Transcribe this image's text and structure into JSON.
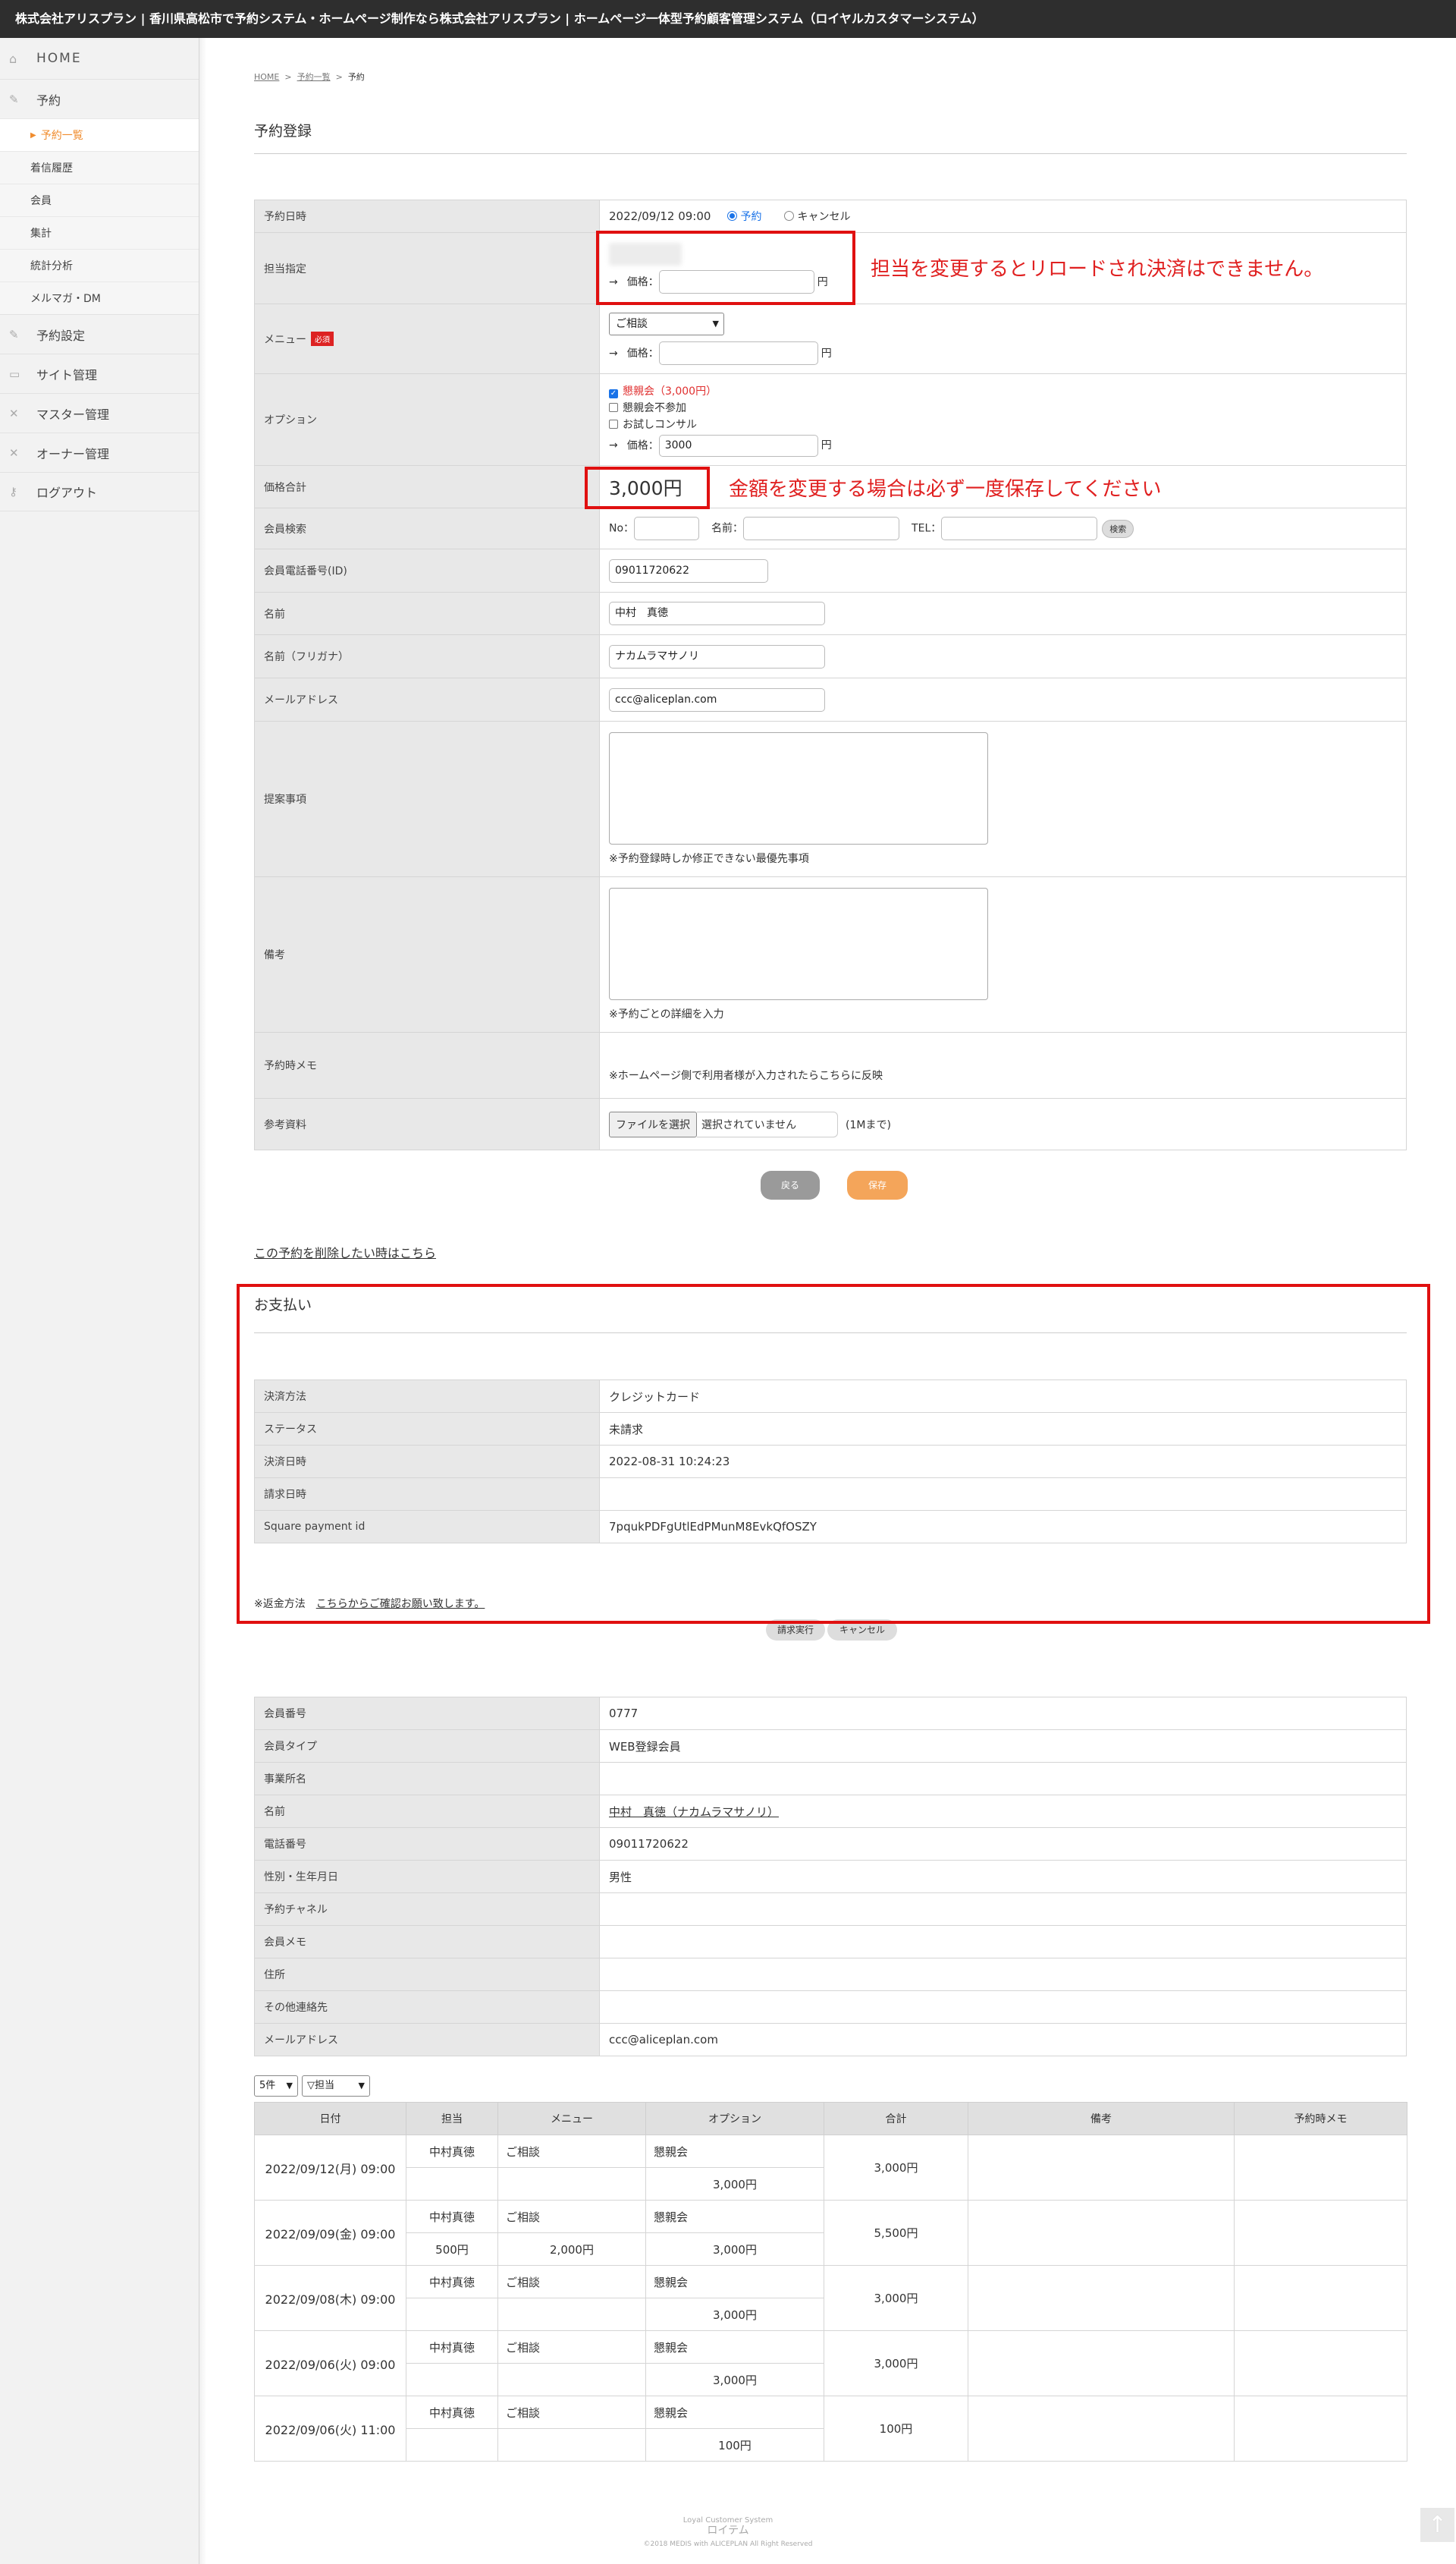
{
  "topbar": {
    "title": "株式会社アリスプラン | 香川県高松市で予約システム・ホームページ制作なら株式会社アリスプラン | ホームページ一体型予約顧客管理システム（ロイヤルカスタマーシステム）"
  },
  "sidebar": {
    "home": "HOME",
    "reserve": "予約",
    "sub": [
      "予約一覧",
      "着信履歴",
      "会員",
      "集計",
      "統計分析",
      "メルマガ・DM"
    ],
    "sections": [
      "予約設定",
      "サイト管理",
      "マスター管理",
      "オーナー管理",
      "ログアウト"
    ]
  },
  "breadcrumb": {
    "home": "HOME",
    "list": "予約一覧",
    "current": "予約"
  },
  "page": {
    "title": "予約登録"
  },
  "form": {
    "datetime": {
      "label": "予約日時",
      "value": "2022/09/12 09:00",
      "opt1": "予約",
      "opt2": "キャンセル"
    },
    "staff": {
      "label": "担当指定",
      "price_label": "価格：",
      "price": "",
      "yen": "円"
    },
    "menu": {
      "label": "メニュー",
      "required": "必須",
      "selected": "ご相談",
      "price_label": "価格：",
      "price": "",
      "yen": "円"
    },
    "option": {
      "label": "オプション",
      "items": [
        "懇親会（3,000円）",
        "懇親会不参加",
        "お試しコンサル"
      ],
      "price_label": "価格：",
      "price": "3000",
      "yen": "円"
    },
    "total": {
      "label": "価格合計",
      "value": "3,000円"
    },
    "member_search": {
      "label": "会員検索",
      "no": "No：",
      "name": "名前：",
      "tel": "TEL：",
      "button": "検索"
    },
    "phone": {
      "label": "会員電話番号(ID)",
      "value": "09011720622"
    },
    "name": {
      "label": "名前",
      "value": "中村　真徳"
    },
    "kana": {
      "label": "名前（フリガナ）",
      "value": "ナカムラマサノリ"
    },
    "email": {
      "label": "メールアドレス",
      "value": "ccc@aliceplan.com"
    },
    "proposal": {
      "label": "提案事項",
      "note": "※予約登録時しか修正できない最優先事項"
    },
    "remarks": {
      "label": "備考",
      "note": "※予約ごとの詳細を入力"
    },
    "memo": {
      "label": "予約時メモ",
      "note": "※ホームページ側で利用者様が入力されたらこちらに反映"
    },
    "attachment": {
      "label": "参考資料",
      "button": "ファイルを選択",
      "status": "選択されていません",
      "limit": "(1Mまで)"
    },
    "back": "戻る",
    "save": "保存"
  },
  "annotations": {
    "staff": "担当を変更するとリロードされ決済はできません。",
    "total": "金額を変更する場合は必ず一度保存してください"
  },
  "delete_link": "この予約を削除したい時はこちら",
  "payment": {
    "title": "お支払い",
    "rows": [
      {
        "label": "決済方法",
        "value": "クレジットカード"
      },
      {
        "label": "ステータス",
        "value": "未請求"
      },
      {
        "label": "決済日時",
        "value": "2022-08-31 10:24:23"
      },
      {
        "label": "請求日時",
        "value": ""
      },
      {
        "label": "Square payment id",
        "value": "7pqukPDFgUtlEdPMunM8EvkQfOSZY"
      }
    ],
    "refund_label": "※返金方法",
    "refund_link": "こちらからご確認お願い致します。",
    "charge": "請求実行",
    "cancel": "キャンセル"
  },
  "member": {
    "rows": [
      {
        "label": "会員番号",
        "value": "0777"
      },
      {
        "label": "会員タイプ",
        "value": "WEB登録会員"
      },
      {
        "label": "事業所名",
        "value": ""
      },
      {
        "label": "名前",
        "value": "中村　真徳（ナカムラマサノリ）"
      },
      {
        "label": "電話番号",
        "value": "09011720622"
      },
      {
        "label": "性別・生年月日",
        "value": "男性"
      },
      {
        "label": "予約チャネル",
        "value": ""
      },
      {
        "label": "会員メモ",
        "value": ""
      },
      {
        "label": "住所",
        "value": ""
      },
      {
        "label": "その他連絡先",
        "value": ""
      },
      {
        "label": "メールアドレス",
        "value": "ccc@aliceplan.com"
      }
    ]
  },
  "history": {
    "count_select": "5件",
    "staff_select": "▽担当",
    "headers": [
      "日付",
      "担当",
      "メニュー",
      "オプション",
      "合計",
      "備考",
      "予約時メモ"
    ],
    "rows": [
      {
        "date": "2022/09/12(月) 09:00",
        "staff": "中村真徳",
        "staff_price": "",
        "menu": "ご相談",
        "menu_price": "",
        "option": "懇親会",
        "option_price": "3,000円",
        "total": "3,000円"
      },
      {
        "date": "2022/09/09(金) 09:00",
        "staff": "中村真徳",
        "staff_price": "500円",
        "menu": "ご相談",
        "menu_price": "2,000円",
        "option": "懇親会",
        "option_price": "3,000円",
        "total": "5,500円"
      },
      {
        "date": "2022/09/08(木) 09:00",
        "staff": "中村真徳",
        "staff_price": "",
        "menu": "ご相談",
        "menu_price": "",
        "option": "懇親会",
        "option_price": "3,000円",
        "total": "3,000円"
      },
      {
        "date": "2022/09/06(火) 09:00",
        "staff": "中村真徳",
        "staff_price": "",
        "menu": "ご相談",
        "menu_price": "",
        "option": "懇親会",
        "option_price": "3,000円",
        "total": "3,000円"
      },
      {
        "date": "2022/09/06(火) 11:00",
        "staff": "中村真徳",
        "staff_price": "",
        "menu": "ご相談",
        "menu_price": "",
        "option": "懇親会",
        "option_price": "100円",
        "total": "100円"
      }
    ]
  },
  "footer": {
    "line1": "Loyal Customer System",
    "line2": "ロイテム",
    "line3": "©2018 MEDIS with ALICEPLAN All Right Reserved"
  }
}
